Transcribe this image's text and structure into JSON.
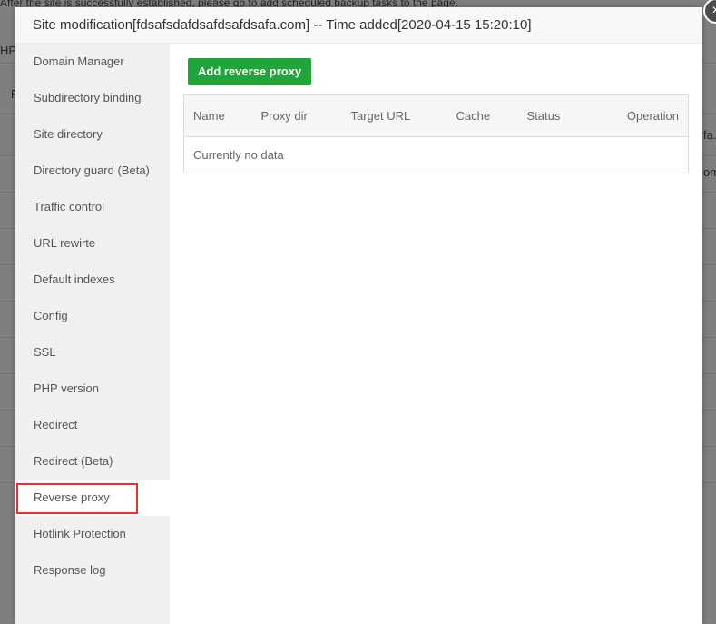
{
  "background": {
    "notice": "After the site is successfully established, please go to add scheduled backup tasks to the page.",
    "col_php": "HP",
    "col_r": "R",
    "frag1": "fa.",
    "frag2": "om"
  },
  "modal": {
    "title": "Site modification[fdsafsdafdsafdsafdsafa.com] -- Time added[2020-04-15 15:20:10]",
    "close_icon": "×",
    "sidebar": [
      "Domain Manager",
      "Subdirectory binding",
      "Site directory",
      "Directory guard (Beta)",
      "Traffic control",
      "URL rewirte",
      "Default indexes",
      "Config",
      "SSL",
      "PHP version",
      "Redirect",
      "Redirect (Beta)",
      "Reverse proxy",
      "Hotlink Protection",
      "Response log"
    ],
    "active_item": "Reverse proxy",
    "add_button": "Add reverse proxy",
    "table": {
      "columns": [
        "Name",
        "Proxy dir",
        "Target URL",
        "Cache",
        "Status",
        "Operation"
      ],
      "empty": "Currently no data"
    },
    "accent": "#20a53a"
  }
}
